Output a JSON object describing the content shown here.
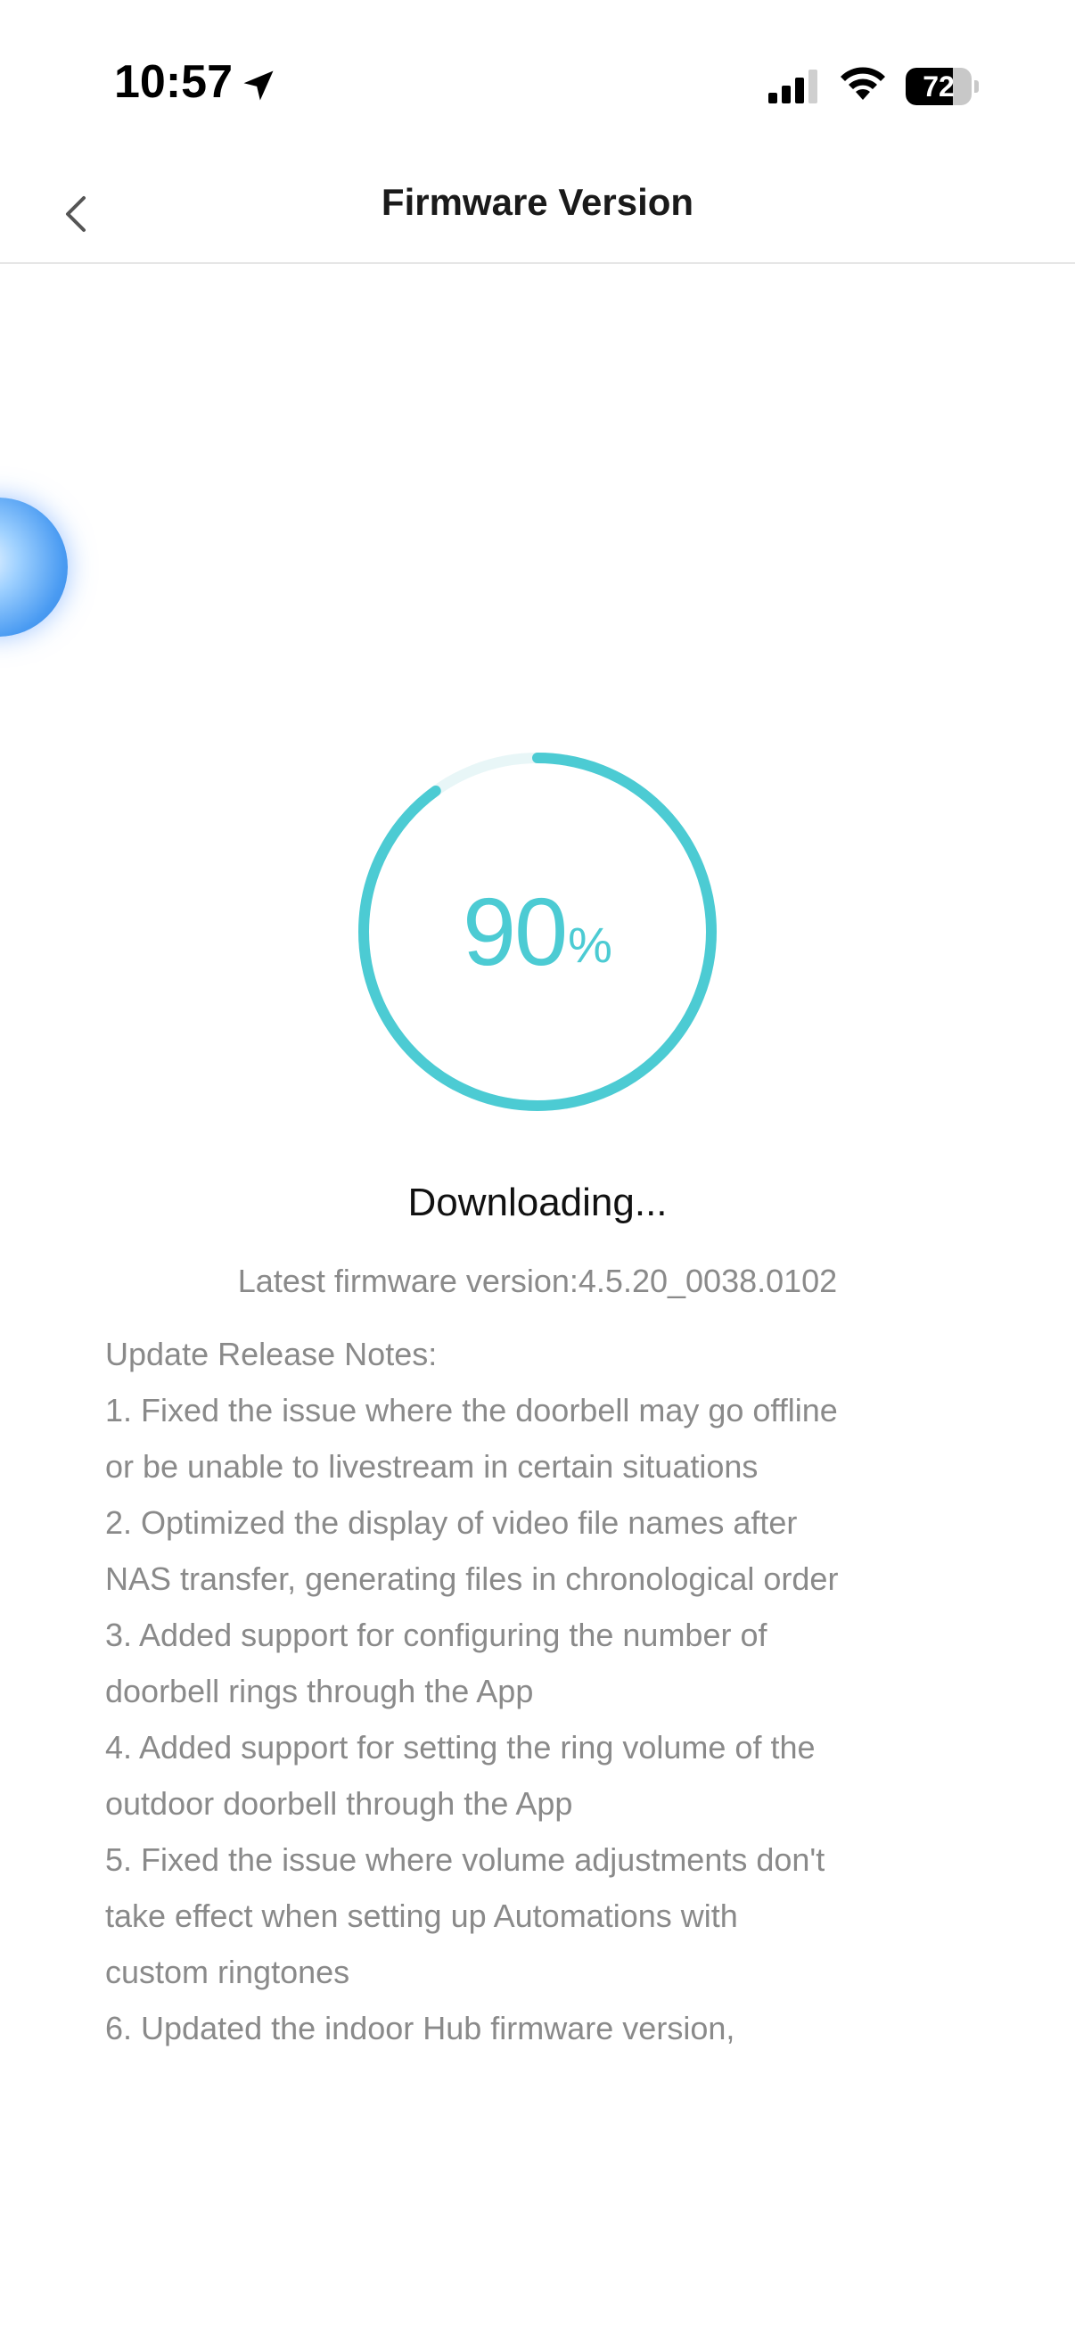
{
  "status_bar": {
    "time": "10:57",
    "battery_level": "72",
    "battery_fraction": 0.72
  },
  "header": {
    "title": "Firmware Version"
  },
  "progress": {
    "value": "90",
    "unit": "%",
    "fraction": 0.9,
    "color": "#4ccbd3",
    "track_color": "#e8f6f7"
  },
  "status": {
    "text": "Downloading..."
  },
  "version": {
    "text": "Latest firmware version:4.5.20_0038.0102"
  },
  "release_notes": {
    "lines": [
      "Update Release Notes:",
      "1. Fixed the issue where the doorbell may go offline",
      "or be unable to livestream in certain situations",
      "2. Optimized the display of video file names after",
      "NAS transfer, generating files in chronological order",
      "3. Added support for configuring the number of",
      "doorbell rings through the App",
      "4. Added support for setting the ring volume of the",
      "outdoor doorbell through the App",
      "5. Fixed the issue where volume adjustments don't",
      "take effect when setting up Automations with",
      "custom ringtones",
      "6. Updated the indoor Hub firmware version,"
    ]
  },
  "icons": {
    "back": "chevron-left-icon",
    "location": "location-arrow-icon",
    "signal": "cellular-signal-icon",
    "wifi": "wifi-icon",
    "battery": "battery-icon",
    "assistant": "assistant-bubble-icon"
  }
}
